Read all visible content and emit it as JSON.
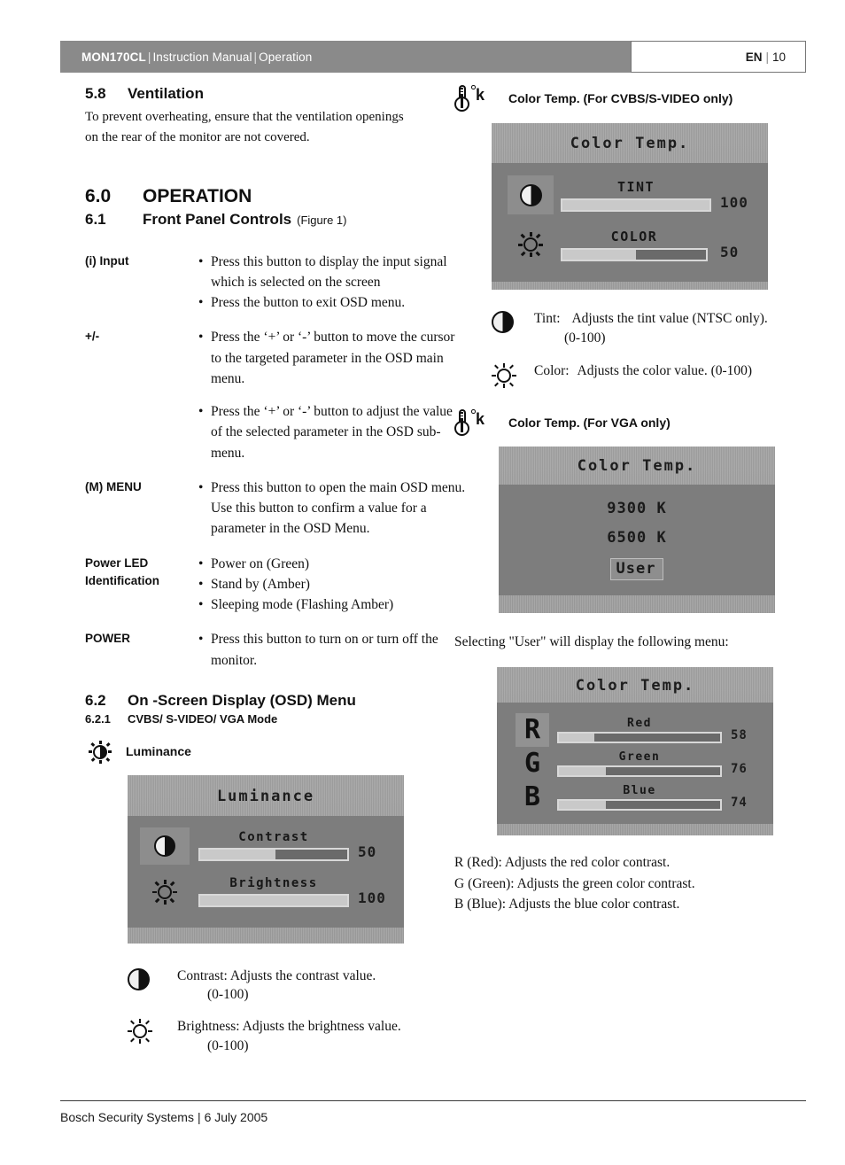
{
  "header": {
    "model": "MON170CL",
    "sep": "|",
    "doc": "Instruction Manual",
    "section": "Operation",
    "lang": "EN",
    "page": "10"
  },
  "left": {
    "s58": {
      "num": "5.8",
      "title": "Ventilation",
      "body": "To prevent overheating, ensure that the ventilation openings on the rear of the monitor are not covered."
    },
    "s60": {
      "num": "6.0",
      "title": "OPERATION"
    },
    "s61": {
      "num": "6.1",
      "title": "Front Panel Controls",
      "figure": "(Figure 1)"
    },
    "controls": [
      {
        "label": [
          "(i) Input"
        ],
        "bullets": [
          "Press this button to display the input signal which is selected on the screen",
          "Press the button to exit OSD menu."
        ],
        "gaps": [
          false,
          false
        ]
      },
      {
        "label": [
          "+/-"
        ],
        "bullets": [
          "Press the ‘+’ or ‘-’ button to move the cursor to the targeted parameter in the OSD main menu.",
          "Press the ‘+’ or ‘-’ button to adjust the value of the selected parameter in the OSD sub-menu."
        ],
        "gaps": [
          false,
          true
        ]
      },
      {
        "label": [
          "(M) MENU"
        ],
        "bullets": [
          "Press this button to open the main OSD menu. Use this button to confirm a value for a parameter in the OSD Menu."
        ],
        "gaps": [
          false
        ]
      },
      {
        "label": [
          "Power LED",
          "Identification"
        ],
        "bullets": [
          "Power on (Green)",
          "Stand by (Amber)",
          "Sleeping mode (Flashing Amber)"
        ],
        "gaps": [
          false,
          false,
          false
        ]
      },
      {
        "label": [
          "POWER"
        ],
        "bullets": [
          "Press this button to turn on or turn off the monitor."
        ],
        "gaps": [
          false
        ]
      }
    ],
    "s62": {
      "num": "6.2",
      "title": "On -Screen Display (OSD) Menu"
    },
    "s621": {
      "num": "6.2.1",
      "title": "CVBS/ S-VIDEO/ VGA Mode"
    },
    "luminance_head": "Luminance",
    "luminance_osd": {
      "title": "Luminance",
      "rows": [
        {
          "icon": "contrast-icon",
          "label": "Contrast",
          "value": "50",
          "fill_pct": 51,
          "selected": true
        },
        {
          "icon": "brightness-icon",
          "label": "Brightness",
          "value": "100",
          "fill_pct": 100,
          "selected": false
        }
      ]
    },
    "legend": [
      {
        "icon": "contrast-icon",
        "text": "Contrast: Adjusts the contrast value.",
        "range": "(0-100)"
      },
      {
        "icon": "brightness-icon",
        "text": "Brightness: Adjusts the brightness value.",
        "range": "(0-100)"
      }
    ]
  },
  "right": {
    "cvbs_head": "Color Temp. (For CVBS/S-VIDEO only)",
    "cvbs_osd": {
      "title": "Color Temp.",
      "rows": [
        {
          "icon": "contrast-icon",
          "label": "TINT",
          "value": "100",
          "fill_pct": 100,
          "selected": true
        },
        {
          "icon": "brightness-icon",
          "label": "COLOR",
          "value": "50",
          "fill_pct": 51,
          "selected": false
        }
      ]
    },
    "cvbs_legend": [
      {
        "icon": "contrast-icon",
        "name": "Tint:",
        "text": "Adjusts the tint value (NTSC only).",
        "range": "(0-100)"
      },
      {
        "icon": "brightness-icon",
        "name": "Color:",
        "text": "Adjusts the color value. (0-100)",
        "range": ""
      }
    ],
    "vga_head": "Color Temp.  (For VGA only)",
    "vga_osd": {
      "title": "Color Temp.",
      "options": [
        "9300 K",
        "6500 K",
        "User"
      ],
      "selected_index": 2
    },
    "user_note": "Selecting \"User\" will display the following menu:",
    "rgb_osd": {
      "title": "Color Temp.",
      "letters": [
        "R",
        "G",
        "B"
      ],
      "rows": [
        {
          "label": "Red",
          "value": "58",
          "fill_pct": 22,
          "selected": true
        },
        {
          "label": "Green",
          "value": "76",
          "fill_pct": 29,
          "selected": false
        },
        {
          "label": "Blue",
          "value": "74",
          "fill_pct": 29,
          "selected": false
        }
      ]
    },
    "rgb_legend": [
      "R (Red): Adjusts the red color contrast.",
      "G (Green): Adjusts the green color contrast.",
      "B (Blue): Adjusts the blue color contrast."
    ]
  },
  "footer": {
    "company": "Bosch Security Systems",
    "sep": "|",
    "date": "6 July 2005"
  },
  "colors": {
    "header_bar": "#8a8a8a",
    "osd_bg": "#a2a2a2",
    "osd_panel": "#7d7d7d",
    "osd_fill": "#c9c9c9",
    "text": "#111111"
  }
}
